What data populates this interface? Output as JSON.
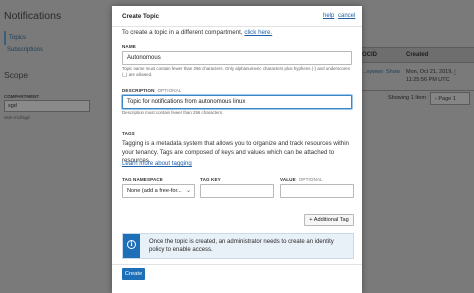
{
  "background": {
    "page_title": "Notifications",
    "nav": {
      "topics": "Topics",
      "subscriptions": "Subscriptions"
    },
    "scope": {
      "heading": "Scope",
      "compartment_label": "COMPARTMENT",
      "compartment_value": "sgd",
      "compartment_path": "dsm-mcl/sgd"
    },
    "table": {
      "columns": [
        "OCID",
        "Created"
      ],
      "rows": [
        {
          "ocid": "...xywwo",
          "show": "Show",
          "created_line1": "Mon, Oct 21, 2019,",
          "created_line2": "11:25:56 PM UTC"
        }
      ],
      "showing": "Showing 1 Item",
      "page": "Page 1"
    }
  },
  "modal": {
    "title": "Create Topic",
    "help_link": "help",
    "cancel_link": "cancel",
    "intro_text": "To create a topic in a different compartment,",
    "intro_link": "click here.",
    "name": {
      "label": "NAME",
      "value": "Autonomous",
      "hint": "Topic name must contain fewer than 256 characters. Only alphanumeric characters plus hyphens (-) and underscores (_) are allowed."
    },
    "description": {
      "label": "DESCRIPTION",
      "optional": "OPTIONAL",
      "value": "Topic for notifications from autonomous linux",
      "hint": "Description must contain fewer than 256 characters."
    },
    "tags": {
      "label": "TAGS",
      "description": "Tagging is a metadata system that allows you to organize and track resources within your tenancy. Tags are composed of keys and values which can be attached to resources.",
      "learn_more": "Learn more about tagging",
      "namespace_label": "TAG NAMESPACE",
      "namespace_value": "None (add a free-for...",
      "key_label": "TAG KEY",
      "key_value": "",
      "value_label": "VALUE",
      "value_optional": "OPTIONAL",
      "value_value": "",
      "add_tag": "+ Additional Tag"
    },
    "info_text": "Once the topic is created, an administrator needs to create an identity policy to enable access.",
    "create_button": "Create"
  },
  "colors": {
    "primary_button": "#1d6fb8",
    "link": "#1d5fa8",
    "info_bar": "#1d6fb8",
    "overlay": "#7a7a7a"
  }
}
